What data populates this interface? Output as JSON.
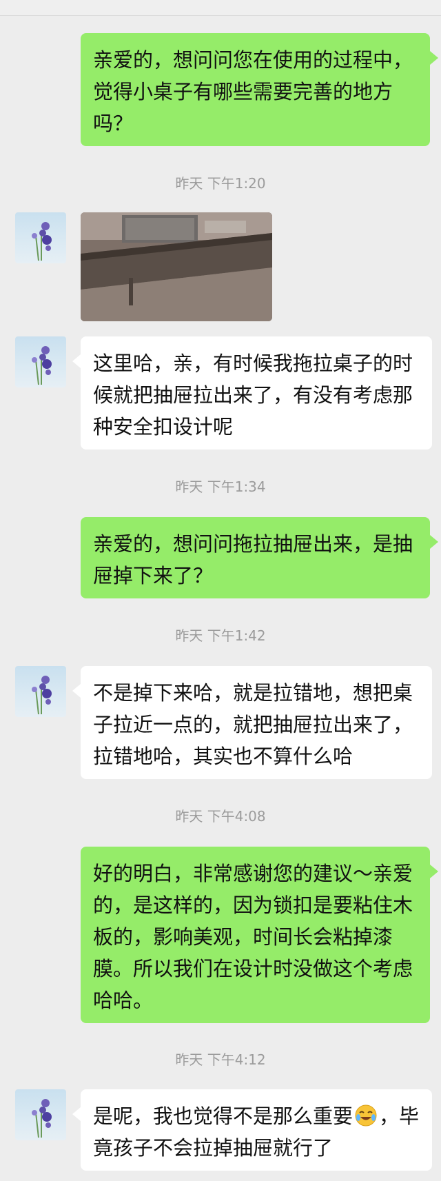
{
  "messages": [
    {
      "type": "out",
      "text": "亲爱的，想问问您在使用的过程中，觉得小桌子有哪些需要完善的地方吗？"
    },
    {
      "type": "ts",
      "text": "昨天 下午1:20"
    },
    {
      "type": "in-image",
      "alt": "desk-photo"
    },
    {
      "type": "in",
      "text": "这里哈，亲，有时候我拖拉桌子的时候就把抽屉拉出来了，有没有考虑那种安全扣设计呢"
    },
    {
      "type": "ts",
      "text": "昨天 下午1:34"
    },
    {
      "type": "out",
      "text": "亲爱的，想问问拖拉抽屉出来，是抽屉掉下来了？"
    },
    {
      "type": "ts",
      "text": "昨天 下午1:42"
    },
    {
      "type": "in",
      "text": "不是掉下来哈，就是拉错地，想把桌子拉近一点的，就把抽屉拉出来了，拉错地哈，其实也不算什么哈"
    },
    {
      "type": "ts",
      "text": "昨天 下午4:08"
    },
    {
      "type": "out",
      "text": "好的明白，非常感谢您的建议～亲爱的，是这样的，因为锁扣是要粘住木板的，影响美观，时间长会粘掉漆膜。所以我们在设计时没做这个考虑哈哈。"
    },
    {
      "type": "ts",
      "text": "昨天 下午4:12"
    },
    {
      "type": "in",
      "text_before_emoji": "是呢，我也觉得不是那么重要",
      "emoji": "laughing-crying-emoji",
      "text_after_emoji": "，毕竟孩子不会拉掉抽屉就行了"
    }
  ],
  "colors": {
    "background": "#ededed",
    "outgoing_bubble": "#95ec69",
    "incoming_bubble": "#ffffff",
    "timestamp": "#9b9b9b"
  }
}
